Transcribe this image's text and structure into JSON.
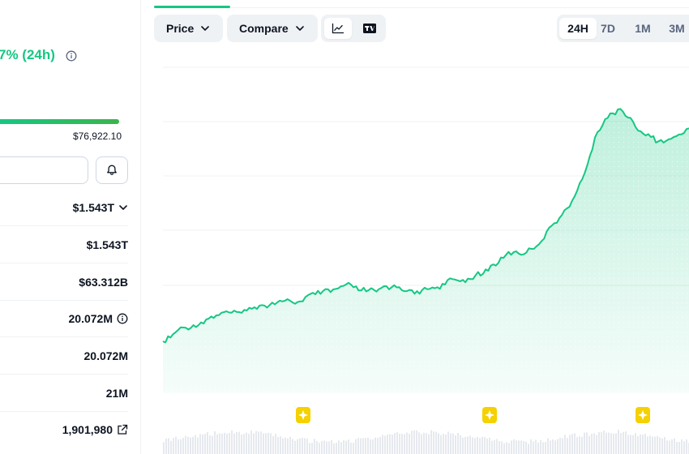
{
  "header": {
    "price_change_text": "7% (24h)",
    "info_icon": "info-circle-icon"
  },
  "range_24h": {
    "high_label": "$76,922.10",
    "fill_fraction": 1.0
  },
  "watch": {
    "bell_icon": "bell-icon"
  },
  "stats": [
    {
      "value": "$1.543T",
      "suffix_icon": "chevron-down-icon"
    },
    {
      "value": "$1.543T",
      "suffix_icon": ""
    },
    {
      "value": "$63.312B",
      "suffix_icon": ""
    },
    {
      "value": "20.072M",
      "suffix_icon": "info-circle-icon"
    },
    {
      "value": "20.072M",
      "suffix_icon": ""
    },
    {
      "value": "21M",
      "suffix_icon": ""
    },
    {
      "value": "1,901,980",
      "suffix_icon": "external-link-icon"
    }
  ],
  "toolbar": {
    "price_label": "Price",
    "compare_label": "Compare",
    "line_chart_icon": "line-chart-icon",
    "tradingview_icon": "tradingview-icon",
    "ranges": [
      "24H",
      "7D",
      "1M",
      "3M"
    ],
    "active_range": "24H"
  },
  "colors": {
    "up": "#16c784",
    "line": "#16c784",
    "grid": "#eff2f5",
    "event_marker": "#f5d100"
  },
  "chart_data": {
    "type": "area",
    "series": [
      {
        "values": [
          38.1,
          38.8,
          40.2,
          40.6,
          41.1,
          41.6,
          42.3,
          42.9,
          43.5,
          43.4,
          43.5,
          43.8,
          44.4,
          44.8,
          44.8,
          45.3,
          45.6,
          45.3,
          45.5,
          46.6,
          46.8,
          47.4,
          47.2,
          47.9,
          48.6,
          48.1,
          47.5,
          47.6,
          47.3,
          48.3,
          48.1,
          48.1,
          47.4,
          46.9,
          47.6,
          47.8,
          48.1,
          48.6,
          49.6,
          49.2,
          49.7,
          50.3,
          50.6,
          52.1,
          52.6,
          54.1,
          54.6,
          54.1,
          55.3,
          55.7,
          57.1,
          59.5,
          60.9,
          62.7,
          64.9,
          68.1,
          72.4,
          76.8,
          79.2,
          80.3,
          81.1,
          79.5,
          77.7,
          76.5,
          75.9,
          75.1,
          75.2,
          75.9,
          76.4,
          77.5
        ]
      }
    ],
    "grid": true,
    "event_markers": 3,
    "ranges": [
      "24H",
      "7D",
      "1M",
      "3M"
    ]
  }
}
